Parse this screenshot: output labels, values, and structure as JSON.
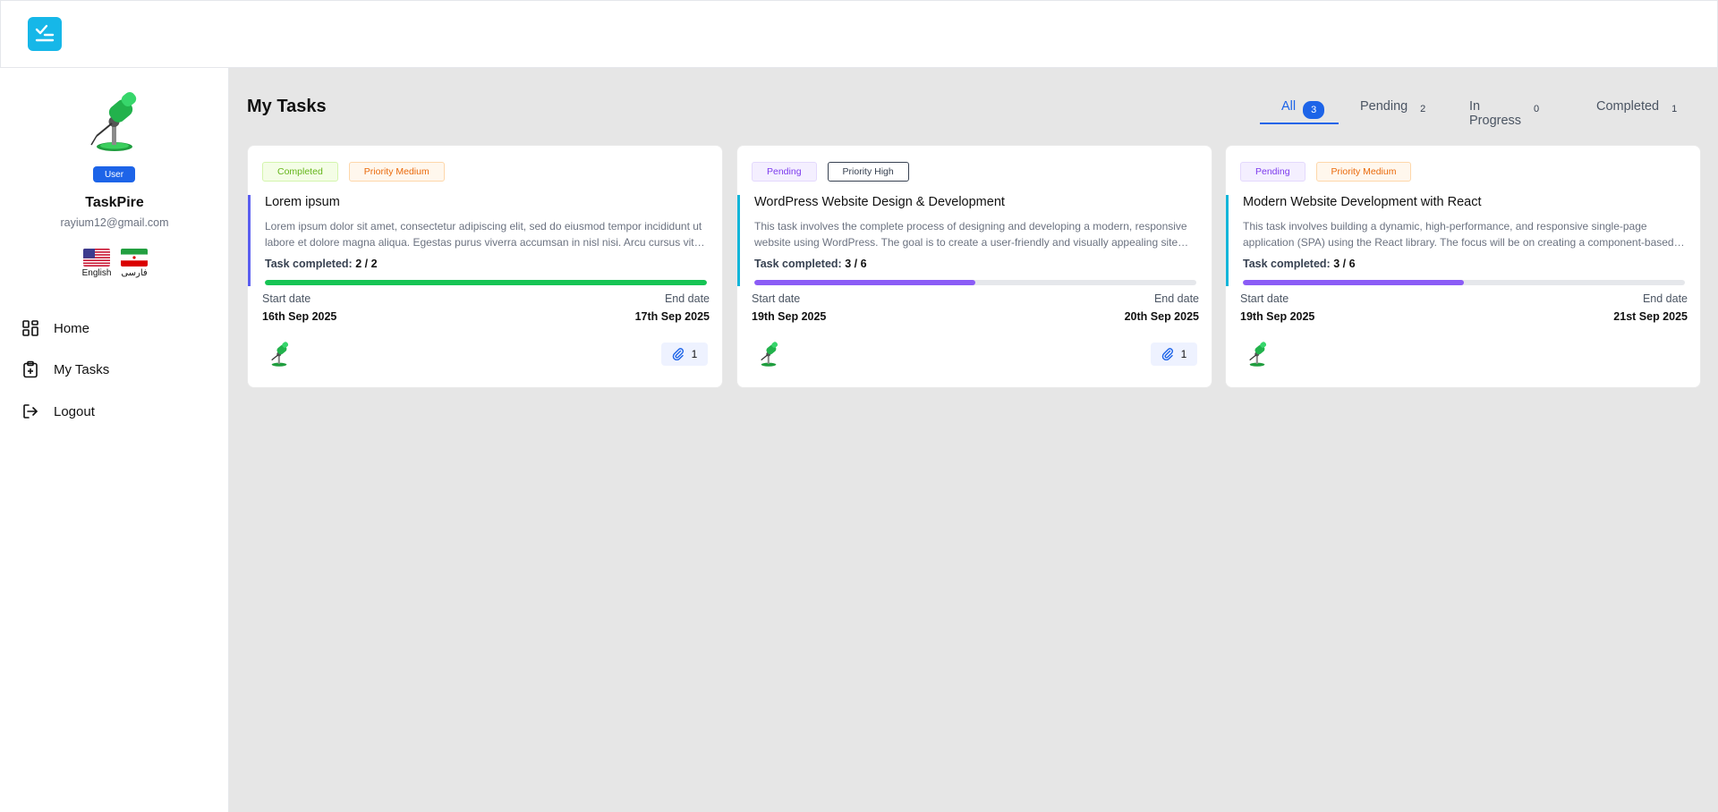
{
  "app": {
    "logo_icon": "checklist-icon",
    "brand_color": "#16b7e8",
    "accent": "#1d64e8"
  },
  "user": {
    "role": "User",
    "name": "TaskPire",
    "email": "rayium12@gmail.com"
  },
  "languages": [
    {
      "label": "English",
      "flag": "us-flag-icon"
    },
    {
      "label": "فارسی",
      "flag": "iran-flag-icon"
    }
  ],
  "nav": [
    {
      "label": "Home",
      "icon": "dashboard-icon"
    },
    {
      "label": "My Tasks",
      "icon": "clipboard-plus-icon"
    },
    {
      "label": "Logout",
      "icon": "logout-icon"
    }
  ],
  "page": {
    "title": "My Tasks"
  },
  "tabs": [
    {
      "label": "All",
      "count": "3",
      "active": true
    },
    {
      "label": "Pending",
      "count": "2"
    },
    {
      "label": "In Progress",
      "count": "0"
    },
    {
      "label": "Completed",
      "count": "1"
    }
  ],
  "tasks": [
    {
      "status": "Completed",
      "priority": "Priority Medium",
      "title": "Lorem ipsum",
      "description": "Lorem ipsum dolor sit amet, consectetur adipiscing elit, sed do eiusmod tempor incididunt ut labore et dolore magna aliqua. Egestas purus viverra accumsan in nisl nisi. Arcu cursus vitae congue mauris rhoncus aenean vel elit scelerisque.",
      "progress_label": "Task completed:",
      "progress_text": "2 / 2",
      "progress": 1.0,
      "progress_color": "#16c454",
      "accent_color": "#5b5ef0",
      "start_label": "Start date",
      "start_date": "16th Sep 2025",
      "end_label": "End date",
      "end_date": "17th Sep 2025",
      "attachments": "1"
    },
    {
      "status": "Pending",
      "priority": "Priority High",
      "title": "WordPress Website Design & Development",
      "description": "This task involves the complete process of designing and developing a modern, responsive website using WordPress. The goal is to create a user-friendly and visually appealing site that meets the client's requirements.",
      "progress_label": "Task completed:",
      "progress_text": "3 / 6",
      "progress": 0.5,
      "progress_color": "#8b5cf6",
      "accent_color": "#13b5d9",
      "start_label": "Start date",
      "start_date": "19th Sep 2025",
      "end_label": "End date",
      "end_date": "20th Sep 2025",
      "attachments": "1"
    },
    {
      "status": "Pending",
      "priority": "Priority Medium",
      "title": "Modern Website Development with React",
      "description": "This task involves building a dynamic, high-performance, and responsive single-page application (SPA) using the React library. The focus will be on creating a component-based architecture that is easy to maintain.",
      "progress_label": "Task completed:",
      "progress_text": "3 / 6",
      "progress": 0.5,
      "progress_color": "#8b5cf6",
      "accent_color": "#13b5d9",
      "start_label": "Start date",
      "start_date": "19th Sep 2025",
      "end_label": "End date",
      "end_date": "21st Sep 2025",
      "attachments": ""
    }
  ]
}
